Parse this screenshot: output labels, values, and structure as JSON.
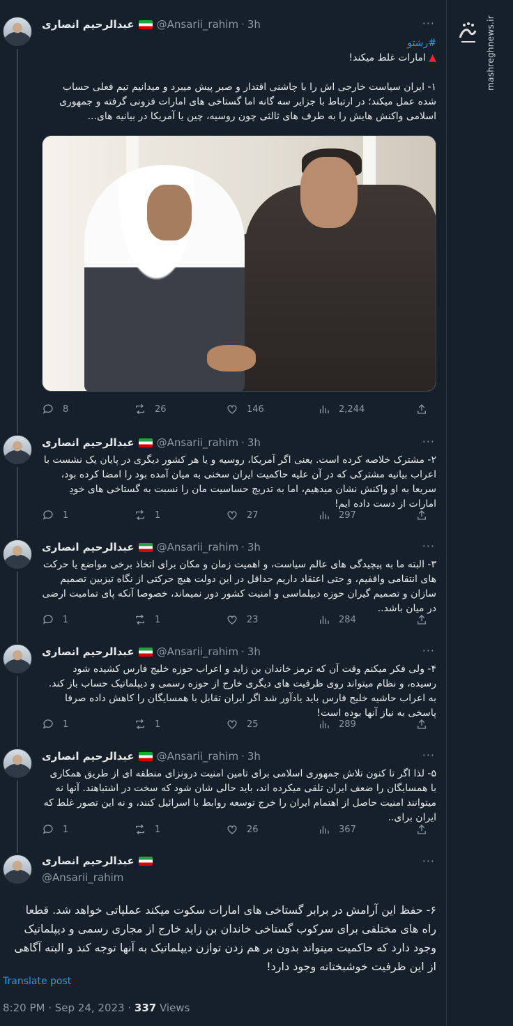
{
  "author": {
    "name": "عبدالرحیم انصاری",
    "handle": "@Ansarii_rahim",
    "time": "3h"
  },
  "watermark": {
    "logo_text": "مشرق",
    "site": "mashreghnews.ir"
  },
  "tweets": [
    {
      "hashtag": "#رشتو",
      "title_icon": "red-triangle-icon",
      "title": "امارات غلط میکند!",
      "text": "۱- ایران سیاست خارجی اش را با چاشنی اقتدار و صبر پیش میبرد و میدانیم تیم فعلی حساب شده عمل میکند؛ در ارتباط با جزایر سه گانه اما گستاخی های امارات فزونی گرفته و جمهوری اسلامی واکنش هایش را به طرف های ثالثی چون روسیه، چین یا آمریکا در بیانیه های...",
      "replies": "8",
      "retweets": "26",
      "likes": "146",
      "views": "2,244"
    },
    {
      "text": "۲- مشترک خلاصه کرده است. یعنی اگر آمریکا، روسیه و یا هر کشور دیگری در پایان یک نشست با اعراب بیانیه مشترکی که در آن علیه حاکمیت ایران سخنی به میان آمده بود را امضا کرده بود، سریعا به او واکنش نشان میدهیم، اما به تدریج حساسیت مان را نسبت به گستاخی های خودِ امارات از دست داده ایم!",
      "replies": "1",
      "retweets": "1",
      "likes": "27",
      "views": "297"
    },
    {
      "text": "۳- البته ما به پیچیدگی های عالم سیاست، و اهمیت زمان و مکان برای اتخاذ برخی مواضع یا حرکت های انتقامی واقفیم، و حتی اعتقاد داریم حداقل در این دولت هیچ حرکتی از نگاه تیزبین تصمیم سازان و تصمیم گیران حوزه دیپلماسی و امنیت کشور دور نمیماند، خصوصا آنکه پای تمامیت ارضی در میان باشد..",
      "replies": "1",
      "retweets": "1",
      "likes": "23",
      "views": "284"
    },
    {
      "text": "۴- ولی فکر میکنم وقت آن که ترمز خاندان بن زاید و اعراب حوزه خلیج فارس کشیده شود رسیده، و نظام میتواند روی ظرفیت های دیگری خارج از حوزه رسمی و دیپلماتیک حساب باز کند. به اعراب حاشیه خلیج فارس باید یادآور شد اگر ایران تقابل با همسایگان را کاهش داده صرفا پاسخی به نیاز آنها بوده است!",
      "replies": "1",
      "retweets": "1",
      "likes": "25",
      "views": "289"
    },
    {
      "text": "۵- لذا اگر تا کنون تلاش جمهوری اسلامی برای تامین امنیت درونزای منطقه ای از طریق همکاری با همسایگان را ضعف ایران تلقی میکرده اند، باید حالی شان شود که سخت در اشتباهند. آنها نه میتوانند امنیت حاصل از اهتمام ایران را خرج توسعه روابط با اسرائیل کنند، و نه این تصور غلط که ایران برای..",
      "replies": "1",
      "retweets": "1",
      "likes": "26",
      "views": "367"
    },
    {
      "text": "۶- حفظ این آرامش در برابر گستاخی های امارات سکوت میکند عملیاتی خواهد شد. قطعا راه های مختلفی برای سرکوب گستاخی خاندان بن زاید خارج از مجاری رسمی و دیپلماتیک وجود دارد که حاکمیت میتواند بدون بر هم زدن توازن دیپلماتیک به آنها توجه کند و البته آگاهی از این ظرفیت خوشبختانه وجود دارد!"
    }
  ],
  "translate_label": "Translate post",
  "footer": {
    "datetime": "8:20 PM · Sep 24, 2023 · ",
    "views_count": "337",
    "views_label": " Views"
  }
}
